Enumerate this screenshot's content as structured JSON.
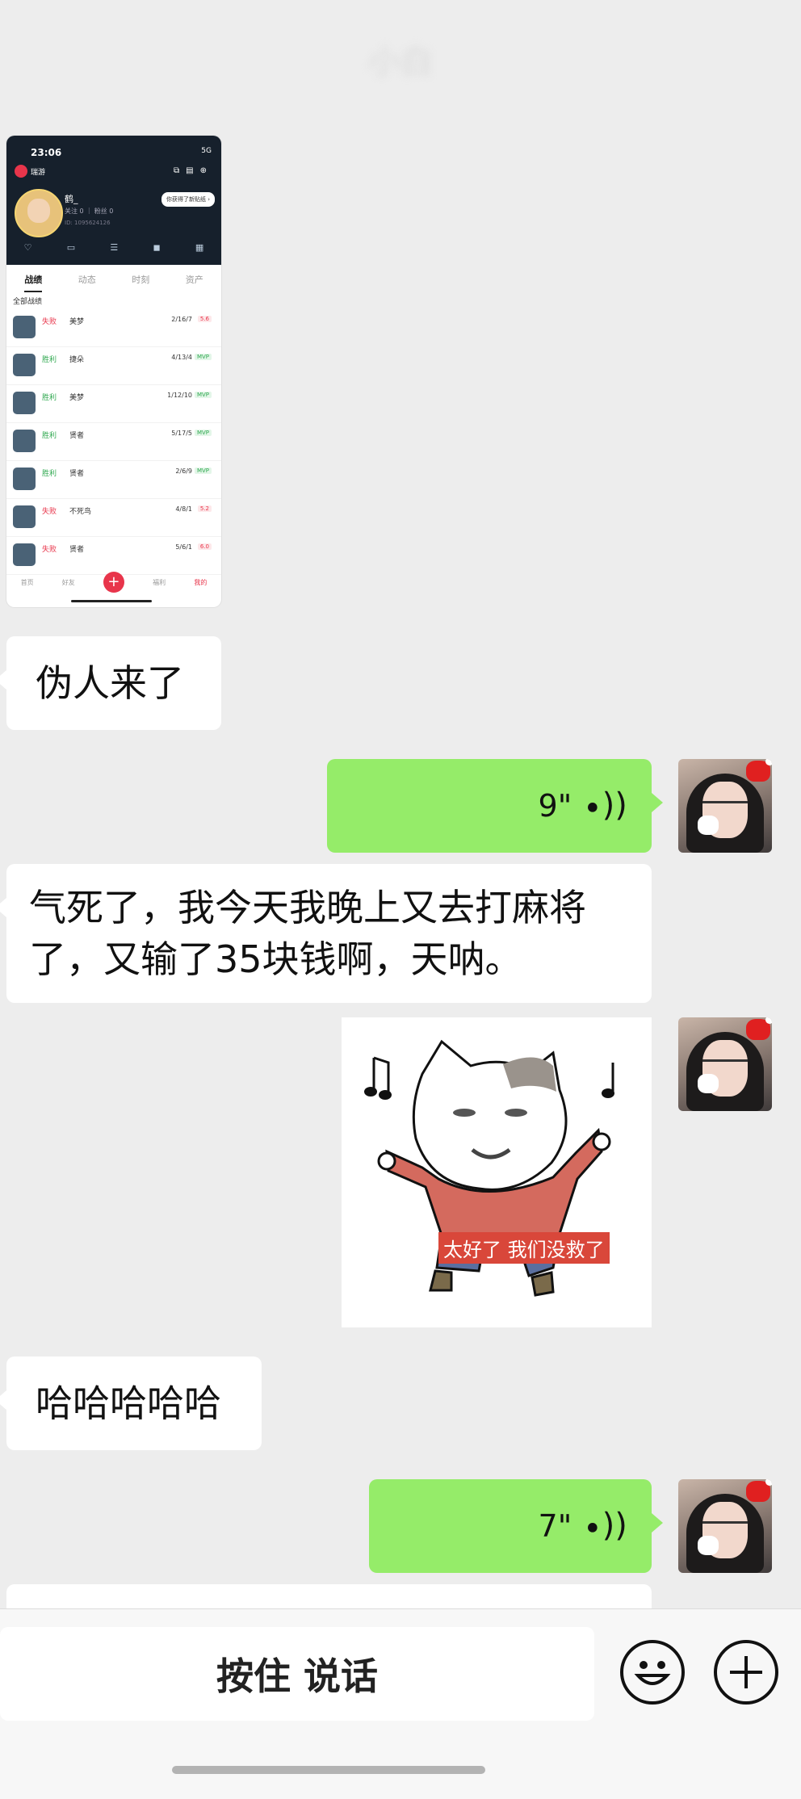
{
  "header": {
    "title": "小白"
  },
  "shared_screenshot": {
    "status_time": "23:06",
    "status_signal": "5G",
    "app_name": "瑞游",
    "nickname": "鹤_",
    "stats": "关注 0 ｜ 粉丝 0",
    "uid": "ID: 1095624126",
    "tip": "你获得了新贴纸 ›",
    "icon_row": [
      "♡",
      "▭",
      "☰",
      "◼",
      "▦"
    ],
    "tabs": [
      "战绩",
      "动态",
      "时刻",
      "资产"
    ],
    "section_title": "全部战绩",
    "matches": [
      {
        "result": "失败",
        "outcome": "lose",
        "hero": "美梦",
        "kda": "2/16/7",
        "score": "5.6"
      },
      {
        "result": "胜利",
        "outcome": "win",
        "hero": "捷朵",
        "kda": "4/13/4",
        "score": "MVP"
      },
      {
        "result": "胜利",
        "outcome": "win",
        "hero": "美梦",
        "kda": "1/12/10",
        "score": "MVP"
      },
      {
        "result": "胜利",
        "outcome": "win",
        "hero": "贤者",
        "kda": "5/17/5",
        "score": "MVP"
      },
      {
        "result": "胜利",
        "outcome": "win",
        "hero": "贤者",
        "kda": "2/6/9",
        "score": "MVP"
      },
      {
        "result": "失败",
        "outcome": "lose",
        "hero": "不死鸟",
        "kda": "4/8/1",
        "score": "5.2"
      },
      {
        "result": "失败",
        "outcome": "lose",
        "hero": "贤者",
        "kda": "5/6/1",
        "score": "6.0"
      }
    ],
    "nav": [
      "首页",
      "好友",
      "+",
      "福利",
      "我的"
    ]
  },
  "messages": {
    "m1": "伪人来了",
    "voice1": "9\"",
    "m2_line1": "气死了，我今天我晚上又去打麻将",
    "m2_line2": "了，又输了35块钱啊，天呐。",
    "sticker_caption": "太好了 我们没救了",
    "m3": "哈哈哈哈哈",
    "voice2": "7\""
  },
  "input_bar": {
    "hold_to_talk": "按住 说话",
    "emoji_icon": "smiley",
    "plus_icon": "plus"
  }
}
